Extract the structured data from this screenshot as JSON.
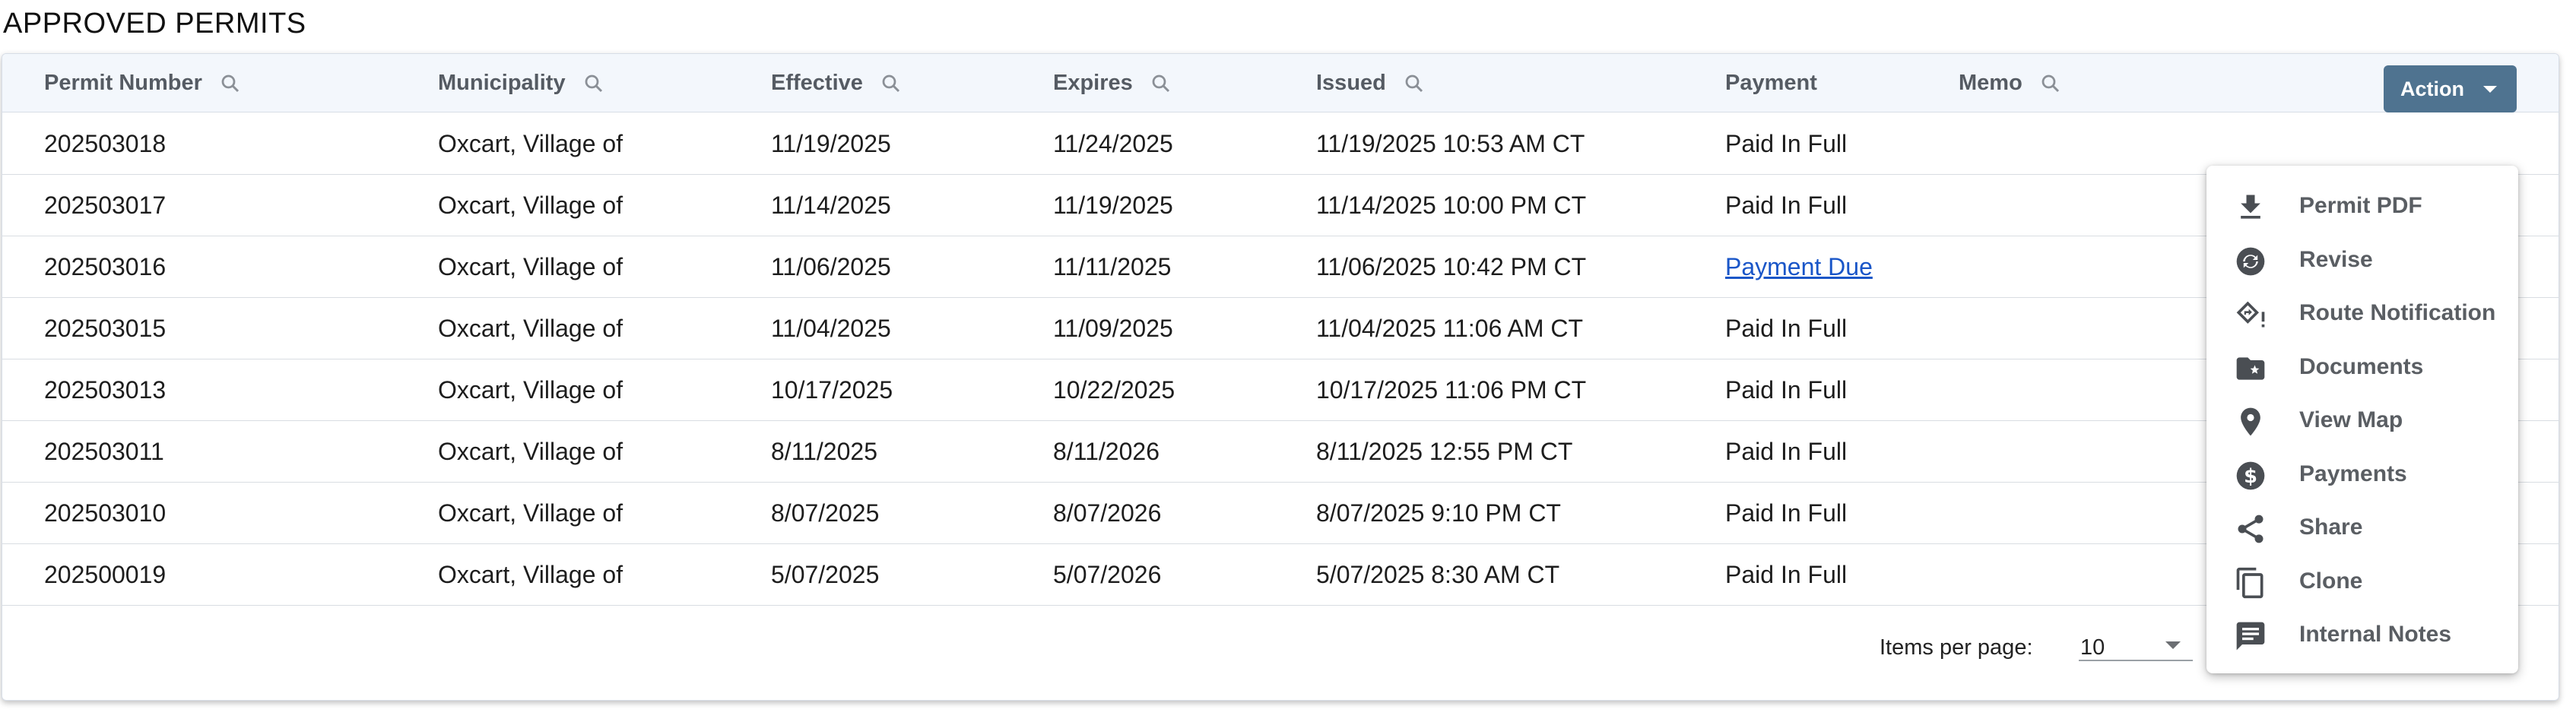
{
  "page": {
    "title": "APPROVED PERMITS"
  },
  "table": {
    "columns": [
      {
        "label": "Permit Number",
        "searchable": true
      },
      {
        "label": "Municipality",
        "searchable": true
      },
      {
        "label": "Effective",
        "searchable": true
      },
      {
        "label": "Expires",
        "searchable": true
      },
      {
        "label": "Issued",
        "searchable": true
      },
      {
        "label": "Payment",
        "searchable": false
      },
      {
        "label": "Memo",
        "searchable": true
      }
    ],
    "rows": [
      {
        "permit": "202503018",
        "municipality": "Oxcart, Village of",
        "effective": "11/19/2025",
        "expires": "11/24/2025",
        "issued": "11/19/2025 10:53 AM CT",
        "payment": "Paid In Full",
        "memo": ""
      },
      {
        "permit": "202503017",
        "municipality": "Oxcart, Village of",
        "effective": "11/14/2025",
        "expires": "11/19/2025",
        "issued": "11/14/2025 10:00 PM CT",
        "payment": "Paid In Full",
        "memo": ""
      },
      {
        "permit": "202503016",
        "municipality": "Oxcart, Village of",
        "effective": "11/06/2025",
        "expires": "11/11/2025",
        "issued": "11/06/2025 10:42 PM CT",
        "payment": "Payment Due",
        "memo": ""
      },
      {
        "permit": "202503015",
        "municipality": "Oxcart, Village of",
        "effective": "11/04/2025",
        "expires": "11/09/2025",
        "issued": "11/04/2025 11:06 AM CT",
        "payment": "Paid In Full",
        "memo": ""
      },
      {
        "permit": "202503013",
        "municipality": "Oxcart, Village of",
        "effective": "10/17/2025",
        "expires": "10/22/2025",
        "issued": "10/17/2025 11:06 PM CT",
        "payment": "Paid In Full",
        "memo": ""
      },
      {
        "permit": "202503011",
        "municipality": "Oxcart, Village of",
        "effective": "8/11/2025",
        "expires": "8/11/2026",
        "issued": "8/11/2025 12:55 PM CT",
        "payment": "Paid In Full",
        "memo": ""
      },
      {
        "permit": "202503010",
        "municipality": "Oxcart, Village of",
        "effective": "8/07/2025",
        "expires": "8/07/2026",
        "issued": "8/07/2025 9:10 PM CT",
        "payment": "Paid In Full",
        "memo": ""
      },
      {
        "permit": "202500019",
        "municipality": "Oxcart, Village of",
        "effective": "5/07/2025",
        "expires": "5/07/2026",
        "issued": "5/07/2025 8:30 AM CT",
        "payment": "Paid In Full",
        "memo": ""
      }
    ]
  },
  "action_button": {
    "label": "Action"
  },
  "action_menu": {
    "items": [
      {
        "label": "Permit PDF",
        "icon": "download-icon"
      },
      {
        "label": "Revise",
        "icon": "revise-icon"
      },
      {
        "label": "Route Notification",
        "icon": "route-notification-icon"
      },
      {
        "label": "Documents",
        "icon": "folder-star-icon"
      },
      {
        "label": "View Map",
        "icon": "map-pin-icon"
      },
      {
        "label": "Payments",
        "icon": "dollar-icon"
      },
      {
        "label": "Share",
        "icon": "share-icon"
      },
      {
        "label": "Clone",
        "icon": "copy-icon"
      },
      {
        "label": "Internal Notes",
        "icon": "notes-icon"
      }
    ]
  },
  "paginator": {
    "items_per_page_label": "Items per page:",
    "page_size": "10"
  },
  "colors": {
    "action_button": "#4f7390",
    "link": "#1a56c8",
    "header_bg": "#f3f7fc"
  }
}
